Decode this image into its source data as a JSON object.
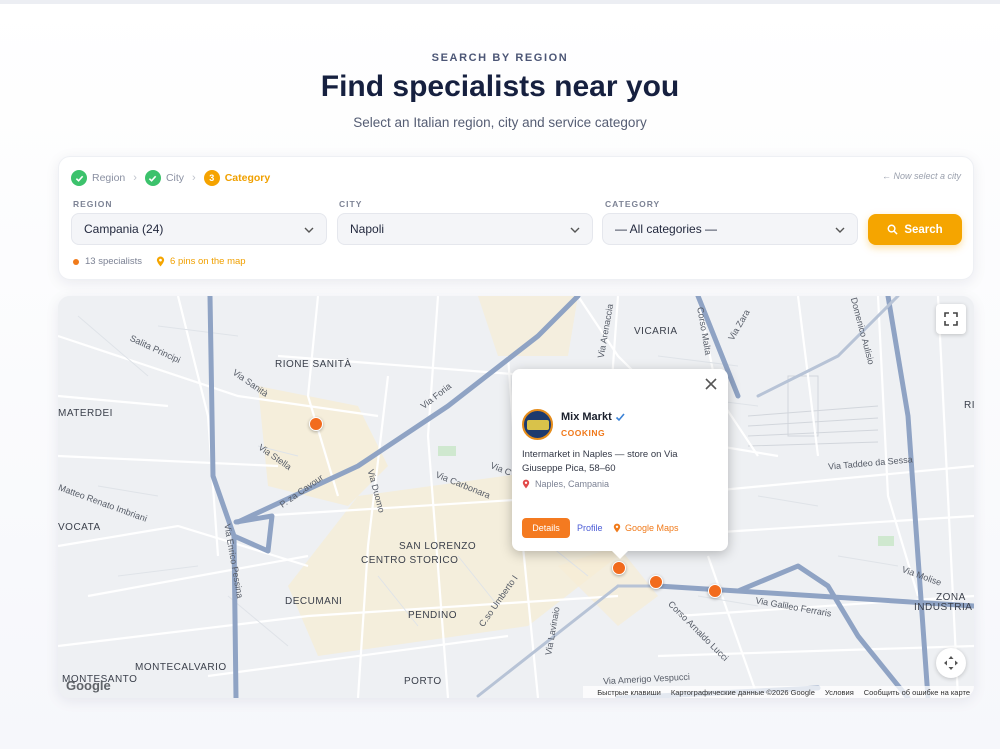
{
  "header": {
    "eyebrow": "SEARCH BY REGION",
    "title": "Find specialists near you",
    "subtitle": "Select an Italian region, city and service category"
  },
  "steps": {
    "region": "Region",
    "city": "City",
    "category_number": "3",
    "category": "Category",
    "hint": "← Now select a city"
  },
  "filters": {
    "region_label": "REGION",
    "region_value": "Campania (24)",
    "city_label": "CITY",
    "city_value": "Napoli",
    "category_label": "CATEGORY",
    "category_value": "— All categories —",
    "search_label": "Search"
  },
  "stats": {
    "specialists": "13 specialists",
    "pins": "6 pins on the map"
  },
  "map": {
    "labels": {
      "rione_sanita": "RIONE SANITÀ",
      "vicaria": "VICARIA",
      "materdei": "MATERDEI",
      "avvocata": "VOCATA",
      "san_lorenzo": "SAN LORENZO",
      "centro_storico": "CENTRO STORICO",
      "decumani": "DECUMANI",
      "pendino": "PENDINO",
      "montecalvario": "MONTECALVARIO",
      "montesanto": "MONTESANTO",
      "porto": "PORTO",
      "zona_industriale": "ZONA",
      "zona_industriale2": "INDUSTRIA",
      "ri": "RI"
    },
    "streets": {
      "via_foria": "Via Foria",
      "salita_principi": "Salita Principi",
      "via_sanita": "Via Sanità",
      "via_stella": "Via Stella",
      "p_za_cavour": "P. za Cavour",
      "via_duomo": "Via Duomo",
      "via_carbonara": "Via Carbonara",
      "matteo_renato": "Matteo Renato Imbriani",
      "via_enrico_pessina": "Via Enrico Pessina",
      "via_arenaccia": "Via Arenaccia",
      "corso_malta": "Corso Malta",
      "via_zara": "Via Zara",
      "domenico_aulisio": "Domenico Aulisio",
      "via_taddeo": "Via Taddeo da Sessa",
      "via_molise": "Via Molise",
      "via_galileo": "Via Galileo Ferraris",
      "corso_lucci": "Corso Arnaldo Lucci",
      "cso_umberto": "C.so Umberto I",
      "via_lavinaio": "Via Lavinaio",
      "via_vespucci": "Via Amerigo Vespucci",
      "via_c": "Via C"
    },
    "google": "Google",
    "attribution": {
      "shortcuts": "Быстрые клавиши",
      "data": "Картографические данные ©2026 Google",
      "terms": "Условия",
      "report": "Сообщить об ошибке на карте"
    }
  },
  "popup": {
    "name": "Mix Markt",
    "category": "COOKING",
    "description": "Intermarket in Naples — store on Via Giuseppe Pica, 58–60",
    "location": "Naples, Campania",
    "details": "Details",
    "profile": "Profile",
    "google_maps": "Google Maps"
  },
  "colors": {
    "accent": "#f5a500",
    "pin": "#f26b1d",
    "check": "#3cc26c",
    "title": "#16203f"
  }
}
